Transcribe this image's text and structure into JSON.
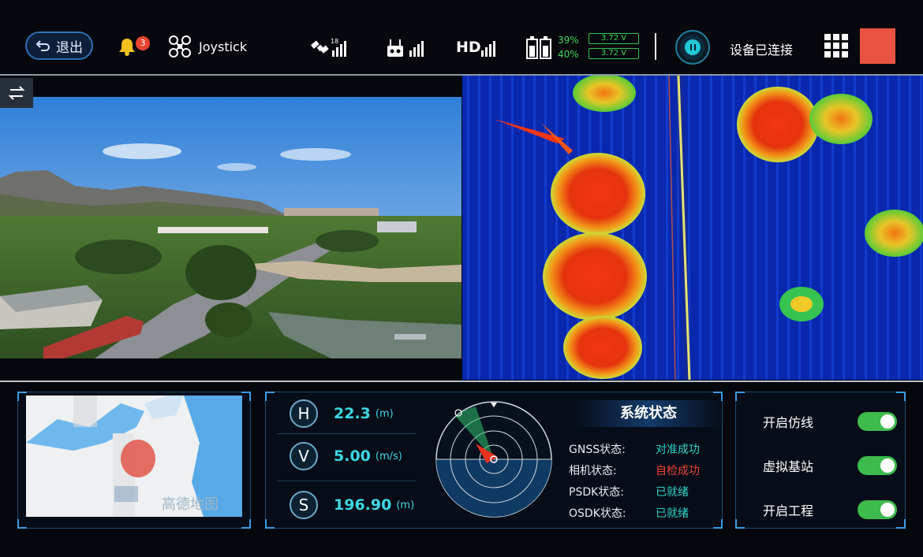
{
  "header": {
    "exit_label": "退出",
    "notification_count": "3",
    "mode_label": "Joystick",
    "gps_satellites": "18",
    "hd_label": "HD",
    "battery": [
      {
        "percent": "39%",
        "voltage": "3.72 V"
      },
      {
        "percent": "40%",
        "voltage": "3.72 V"
      }
    ],
    "device_status": "设备已连接"
  },
  "colors": {
    "accent": "#3fd7e2",
    "ok": "#2fd2c8",
    "error": "#ef4135",
    "record": "#ea5342",
    "battery": "#3ed65a",
    "toggle_on": "#3dbb4d"
  },
  "map": {
    "watermark": "高德地图"
  },
  "telemetry": {
    "height": {
      "badge": "H",
      "value": "22.3",
      "unit": "(m)"
    },
    "speed": {
      "badge": "V",
      "value": "5.00",
      "unit": "(m/s)"
    },
    "distance": {
      "badge": "S",
      "value": "196.90",
      "unit": "(m)"
    }
  },
  "system_status": {
    "title": "系统状态",
    "rows": [
      {
        "key": "GNSS状态:",
        "value": "对准成功",
        "state": "ok"
      },
      {
        "key": "相机状态:",
        "value": "自检成功",
        "state": "error"
      },
      {
        "key": "PSDK状态:",
        "value": "已就绪",
        "state": "ok"
      },
      {
        "key": "OSDK状态:",
        "value": "已就绪",
        "state": "ok"
      }
    ]
  },
  "switches": [
    {
      "label": "开启仿线",
      "on": true
    },
    {
      "label": "虚拟基站",
      "on": true
    },
    {
      "label": "开启工程",
      "on": true
    }
  ],
  "icons": {
    "exit": "back-arrow-icon",
    "bell": "bell-icon",
    "drone": "drone-icon",
    "gps": "satellite-icon",
    "rc": "remote-controller-icon",
    "battery": "battery-icon",
    "pause": "pause-icon",
    "menu": "grid-menu-icon",
    "swap": "swap-icon"
  }
}
